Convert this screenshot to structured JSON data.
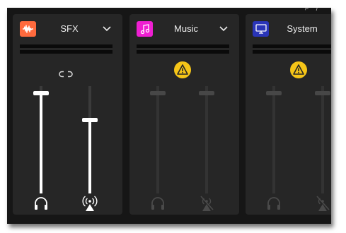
{
  "window": {
    "corner_glyphs": "⌐ /"
  },
  "colors": {
    "panel_bg": "#262626",
    "window_bg": "#161616",
    "warning": "#f5c518"
  },
  "channels": [
    {
      "name": "SFX",
      "icon": "waveform-icon",
      "icon_color": "#ff6a3d",
      "state": "active",
      "link_icon": "link-icon",
      "headphone_volume": 0.95,
      "stream_volume": 0.69
    },
    {
      "name": "Music",
      "icon": "music-note-icon",
      "icon_color": "#ee1fd2",
      "state": "warning",
      "warning_icon": "warning-icon",
      "headphone_volume": 0.95,
      "stream_volume": 0.95
    },
    {
      "name": "System",
      "icon": "monitor-icon",
      "icon_color": "#2a35b8",
      "state": "warning",
      "warning_icon": "warning-icon",
      "headphone_volume": 0.95,
      "stream_volume": 0.95
    }
  ]
}
